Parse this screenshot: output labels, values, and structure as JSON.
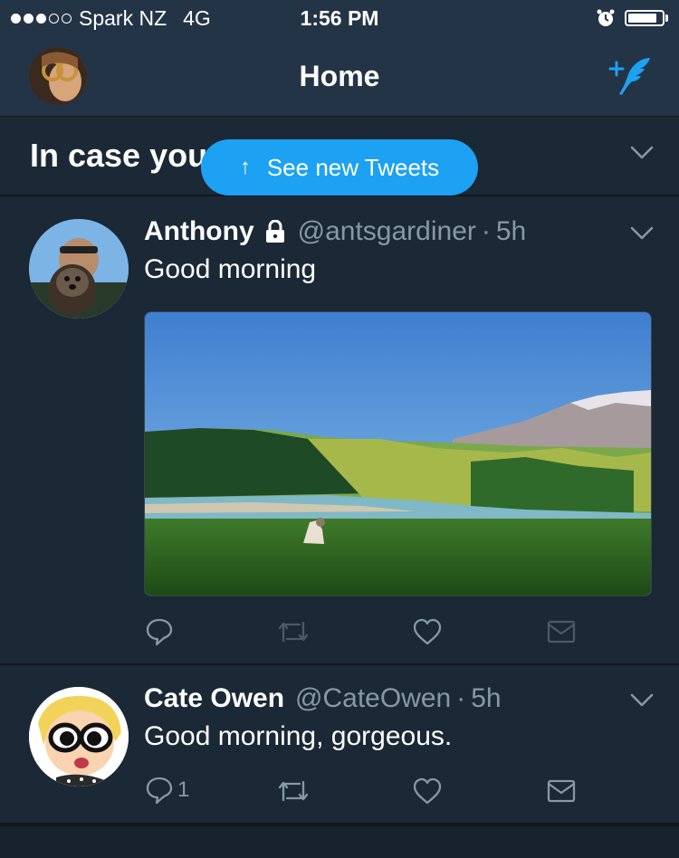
{
  "status_bar": {
    "carrier": "Spark NZ",
    "network": "4G",
    "time": "1:56 PM",
    "signal_bars": 3,
    "signal_total": 5,
    "battery_level": 0.85
  },
  "nav": {
    "title": "Home",
    "avatar_icon": "profile-avatar",
    "compose_icon": "compose-tweet-icon"
  },
  "section": {
    "title": "In case you"
  },
  "new_tweets_pill": {
    "arrow": "↑",
    "label": "See new Tweets"
  },
  "tweets": [
    {
      "name": "Anthony",
      "protected": true,
      "handle": "@antsgardiner",
      "separator": "·",
      "time": "5h",
      "text": "Good morning",
      "has_media": true,
      "reply_count": "",
      "retweet_enabled": false
    },
    {
      "name": "Cate Owen",
      "protected": false,
      "handle": "@CateOwen",
      "separator": "·",
      "time": "5h",
      "text": "Good morning, gorgeous.",
      "has_media": false,
      "reply_count": "1",
      "retweet_enabled": true
    }
  ],
  "colors": {
    "background": "#1b2836",
    "header": "#243447",
    "accent": "#1da1f2",
    "secondary_text": "#8899a6",
    "divider": "#10171e"
  }
}
